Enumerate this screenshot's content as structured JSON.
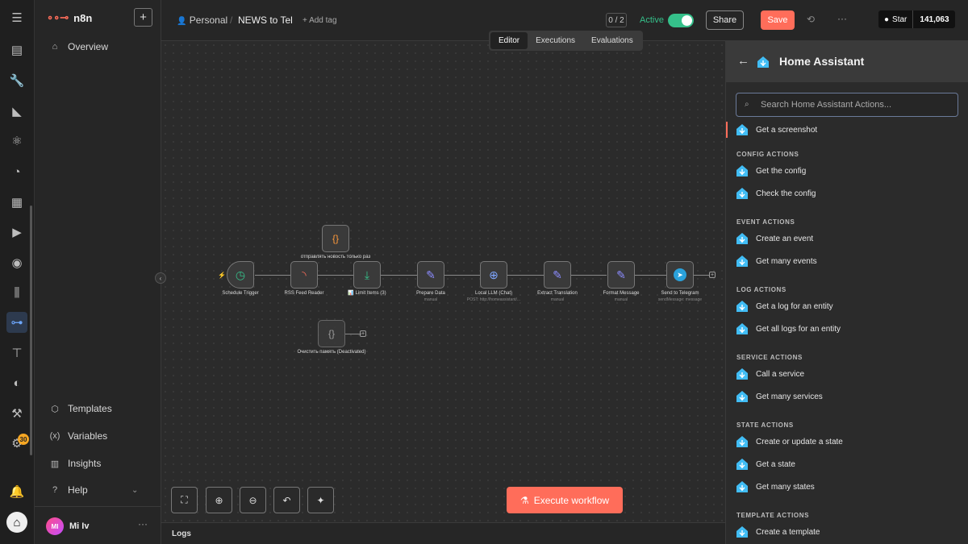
{
  "app": {
    "brand": "n8n"
  },
  "sidebar": {
    "overview": "Overview",
    "bottom_items": [
      {
        "label": "Templates",
        "icon": "templates-icon"
      },
      {
        "label": "Variables",
        "icon": "variables-icon"
      },
      {
        "label": "Insights",
        "icon": "insights-icon"
      },
      {
        "label": "Help",
        "icon": "help-icon"
      }
    ],
    "user": {
      "initials": "MI",
      "name": "Mi Iv"
    },
    "badge": "30"
  },
  "header": {
    "project": "Personal",
    "workflow_name": "NEWS to Tel",
    "add_tag": "+ Add tag",
    "counter": "0 / 2",
    "active_label": "Active",
    "share": "Share",
    "save": "Save",
    "github_star": "Star",
    "github_count": "141,063"
  },
  "tabs": [
    "Editor",
    "Executions",
    "Evaluations"
  ],
  "canvas": {
    "nodes": [
      {
        "label": "Schedule Trigger",
        "sub": ""
      },
      {
        "label": "RSS Feed Reader",
        "sub": ""
      },
      {
        "label": "отправлять новость только раз",
        "sub": ""
      },
      {
        "label": "📊 Limit Items (3)",
        "sub": ""
      },
      {
        "label": "Prepare Data",
        "sub": "manual"
      },
      {
        "label": "Local LLM (Chat)",
        "sub": "POST: http://homeassistant/..."
      },
      {
        "label": "Extract Translation",
        "sub": "manual"
      },
      {
        "label": "Format Message",
        "sub": "manual"
      },
      {
        "label": "Send to Telegram",
        "sub": "sendMessage: message"
      },
      {
        "label": "Очистить память (Deactivated)",
        "sub": ""
      }
    ],
    "execute_button": "Execute workflow",
    "logs_label": "Logs"
  },
  "panel": {
    "title": "Home Assistant",
    "search_placeholder": "Search Home Assistant Actions...",
    "partial_item": "Get a screenshot",
    "sections": [
      {
        "title": "CONFIG ACTIONS",
        "items": [
          "Get the config",
          "Check the config"
        ]
      },
      {
        "title": "EVENT ACTIONS",
        "items": [
          "Create an event",
          "Get many events"
        ]
      },
      {
        "title": "LOG ACTIONS",
        "items": [
          "Get a log for an entity",
          "Get all logs for an entity"
        ]
      },
      {
        "title": "SERVICE ACTIONS",
        "items": [
          "Call a service",
          "Get many services"
        ]
      },
      {
        "title": "STATE ACTIONS",
        "items": [
          "Create or update a state",
          "Get a state",
          "Get many states"
        ]
      },
      {
        "title": "TEMPLATE ACTIONS",
        "items": [
          "Create a template"
        ]
      }
    ]
  },
  "colors": {
    "accent": "#ff6d5a",
    "active": "#35c08a",
    "ha_blue": "#41bdf5"
  }
}
